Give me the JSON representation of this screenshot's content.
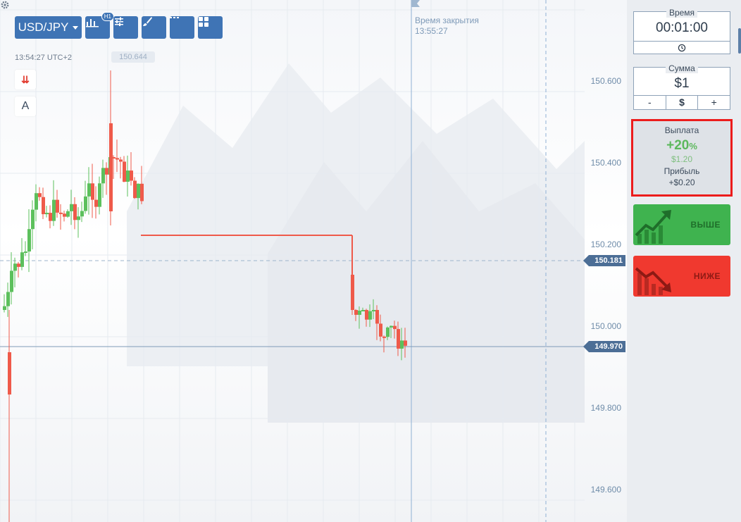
{
  "toolbar": {
    "pair": "USD/JPY",
    "timeframe_badge": "H1"
  },
  "info": {
    "clock": "13:54:27  UTC+2",
    "price_pill": "150.644"
  },
  "tools": {
    "arrows_glyph": "⇊",
    "text_glyph": "A"
  },
  "chart": {
    "close_time_label": "Время закрытия",
    "close_time_value": "13:55:27",
    "price_levels": [
      "150.600",
      "150.400",
      "150.200",
      "150.000",
      "149.800",
      "149.600"
    ],
    "current_price_tag": "150.181",
    "crosshair_price_tag": "149.970"
  },
  "panel": {
    "time_label": "Время",
    "time_value": "00:01:00",
    "sum_label": "Сумма",
    "sum_value": "$1",
    "sum_minus": "-",
    "sum_currency": "$",
    "sum_plus": "+",
    "payout_label": "Выплата",
    "payout_percent": "+20",
    "payout_percent_sign": "%",
    "payout_amount": "$1.20",
    "profit_label": "Прибыль",
    "profit_value": "+$0.20",
    "up_label": "ВЫШЕ",
    "down_label": "НИЖЕ"
  },
  "colors": {
    "accent": "#3f74b5",
    "up": "#3fb34f",
    "down": "#f0392f",
    "candle_up": "#5cc05c",
    "candle_down": "#ef5a4a",
    "highlight": "#ec1c1c"
  },
  "icons": [
    "chart-bars-icon",
    "sliders-icon",
    "brush-icon",
    "dash-line-icon",
    "grid-layout-icon",
    "gear-icon",
    "clock-icon",
    "trend-up-icon",
    "trend-down-icon"
  ]
}
